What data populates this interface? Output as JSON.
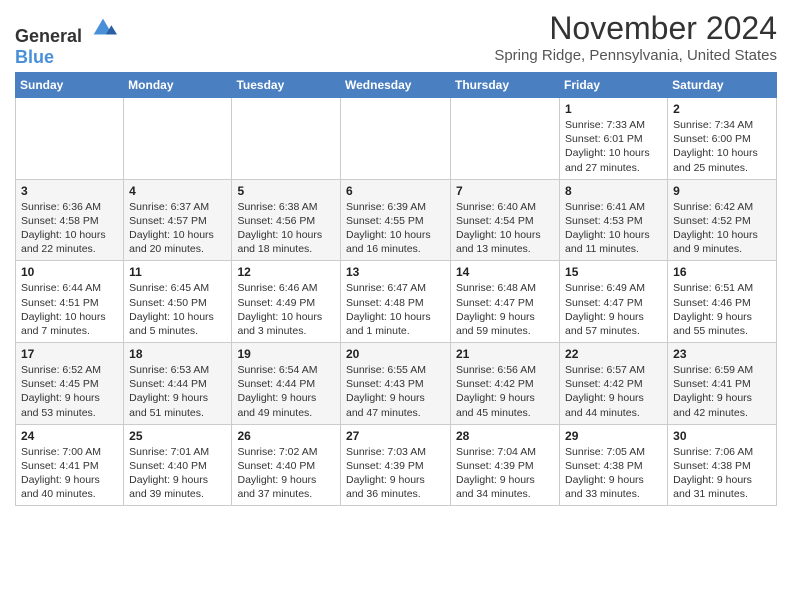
{
  "logo": {
    "text_general": "General",
    "text_blue": "Blue"
  },
  "header": {
    "month_year": "November 2024",
    "location": "Spring Ridge, Pennsylvania, United States"
  },
  "weekdays": [
    "Sunday",
    "Monday",
    "Tuesday",
    "Wednesday",
    "Thursday",
    "Friday",
    "Saturday"
  ],
  "weeks": [
    [
      {
        "day": "",
        "info": ""
      },
      {
        "day": "",
        "info": ""
      },
      {
        "day": "",
        "info": ""
      },
      {
        "day": "",
        "info": ""
      },
      {
        "day": "",
        "info": ""
      },
      {
        "day": "1",
        "info": "Sunrise: 7:33 AM\nSunset: 6:01 PM\nDaylight: 10 hours and 27 minutes."
      },
      {
        "day": "2",
        "info": "Sunrise: 7:34 AM\nSunset: 6:00 PM\nDaylight: 10 hours and 25 minutes."
      }
    ],
    [
      {
        "day": "3",
        "info": "Sunrise: 6:36 AM\nSunset: 4:58 PM\nDaylight: 10 hours and 22 minutes."
      },
      {
        "day": "4",
        "info": "Sunrise: 6:37 AM\nSunset: 4:57 PM\nDaylight: 10 hours and 20 minutes."
      },
      {
        "day": "5",
        "info": "Sunrise: 6:38 AM\nSunset: 4:56 PM\nDaylight: 10 hours and 18 minutes."
      },
      {
        "day": "6",
        "info": "Sunrise: 6:39 AM\nSunset: 4:55 PM\nDaylight: 10 hours and 16 minutes."
      },
      {
        "day": "7",
        "info": "Sunrise: 6:40 AM\nSunset: 4:54 PM\nDaylight: 10 hours and 13 minutes."
      },
      {
        "day": "8",
        "info": "Sunrise: 6:41 AM\nSunset: 4:53 PM\nDaylight: 10 hours and 11 minutes."
      },
      {
        "day": "9",
        "info": "Sunrise: 6:42 AM\nSunset: 4:52 PM\nDaylight: 10 hours and 9 minutes."
      }
    ],
    [
      {
        "day": "10",
        "info": "Sunrise: 6:44 AM\nSunset: 4:51 PM\nDaylight: 10 hours and 7 minutes."
      },
      {
        "day": "11",
        "info": "Sunrise: 6:45 AM\nSunset: 4:50 PM\nDaylight: 10 hours and 5 minutes."
      },
      {
        "day": "12",
        "info": "Sunrise: 6:46 AM\nSunset: 4:49 PM\nDaylight: 10 hours and 3 minutes."
      },
      {
        "day": "13",
        "info": "Sunrise: 6:47 AM\nSunset: 4:48 PM\nDaylight: 10 hours and 1 minute."
      },
      {
        "day": "14",
        "info": "Sunrise: 6:48 AM\nSunset: 4:47 PM\nDaylight: 9 hours and 59 minutes."
      },
      {
        "day": "15",
        "info": "Sunrise: 6:49 AM\nSunset: 4:47 PM\nDaylight: 9 hours and 57 minutes."
      },
      {
        "day": "16",
        "info": "Sunrise: 6:51 AM\nSunset: 4:46 PM\nDaylight: 9 hours and 55 minutes."
      }
    ],
    [
      {
        "day": "17",
        "info": "Sunrise: 6:52 AM\nSunset: 4:45 PM\nDaylight: 9 hours and 53 minutes."
      },
      {
        "day": "18",
        "info": "Sunrise: 6:53 AM\nSunset: 4:44 PM\nDaylight: 9 hours and 51 minutes."
      },
      {
        "day": "19",
        "info": "Sunrise: 6:54 AM\nSunset: 4:44 PM\nDaylight: 9 hours and 49 minutes."
      },
      {
        "day": "20",
        "info": "Sunrise: 6:55 AM\nSunset: 4:43 PM\nDaylight: 9 hours and 47 minutes."
      },
      {
        "day": "21",
        "info": "Sunrise: 6:56 AM\nSunset: 4:42 PM\nDaylight: 9 hours and 45 minutes."
      },
      {
        "day": "22",
        "info": "Sunrise: 6:57 AM\nSunset: 4:42 PM\nDaylight: 9 hours and 44 minutes."
      },
      {
        "day": "23",
        "info": "Sunrise: 6:59 AM\nSunset: 4:41 PM\nDaylight: 9 hours and 42 minutes."
      }
    ],
    [
      {
        "day": "24",
        "info": "Sunrise: 7:00 AM\nSunset: 4:41 PM\nDaylight: 9 hours and 40 minutes."
      },
      {
        "day": "25",
        "info": "Sunrise: 7:01 AM\nSunset: 4:40 PM\nDaylight: 9 hours and 39 minutes."
      },
      {
        "day": "26",
        "info": "Sunrise: 7:02 AM\nSunset: 4:40 PM\nDaylight: 9 hours and 37 minutes."
      },
      {
        "day": "27",
        "info": "Sunrise: 7:03 AM\nSunset: 4:39 PM\nDaylight: 9 hours and 36 minutes."
      },
      {
        "day": "28",
        "info": "Sunrise: 7:04 AM\nSunset: 4:39 PM\nDaylight: 9 hours and 34 minutes."
      },
      {
        "day": "29",
        "info": "Sunrise: 7:05 AM\nSunset: 4:38 PM\nDaylight: 9 hours and 33 minutes."
      },
      {
        "day": "30",
        "info": "Sunrise: 7:06 AM\nSunset: 4:38 PM\nDaylight: 9 hours and 31 minutes."
      }
    ]
  ]
}
